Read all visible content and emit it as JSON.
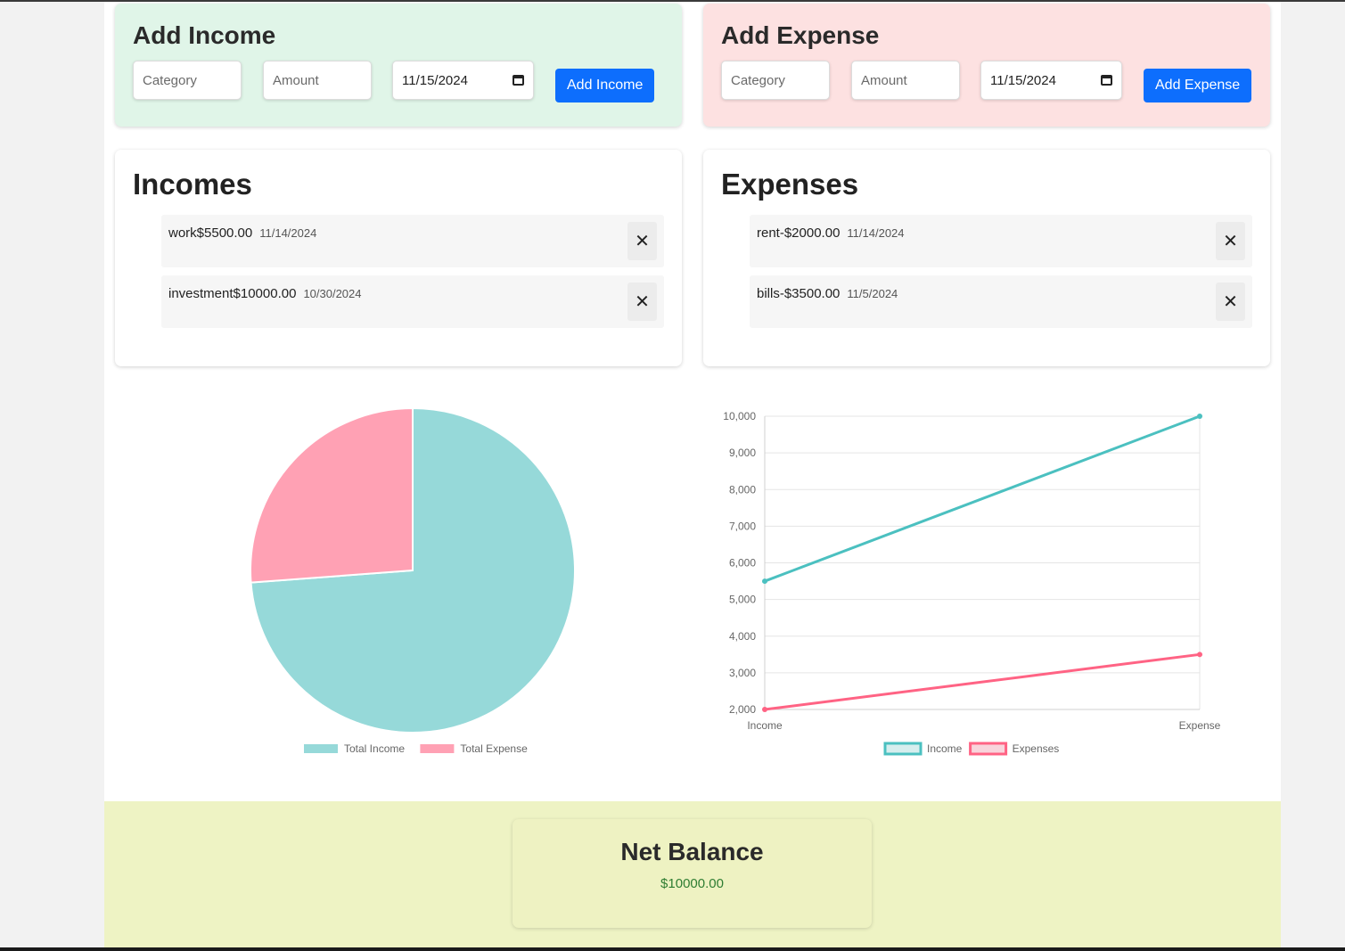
{
  "income_form": {
    "title": "Add Income",
    "category_placeholder": "Category",
    "amount_placeholder": "Amount",
    "date_value": "11/15/2024",
    "button_label": "Add Income"
  },
  "expense_form": {
    "title": "Add Expense",
    "category_placeholder": "Category",
    "amount_placeholder": "Amount",
    "date_value": "11/15/2024",
    "button_label": "Add Expense"
  },
  "incomes": {
    "title": "Incomes",
    "items": [
      {
        "text": "work$5500.00",
        "date": "11/14/2024"
      },
      {
        "text": "investment$10000.00",
        "date": "10/30/2024"
      }
    ]
  },
  "expenses": {
    "title": "Expenses",
    "items": [
      {
        "text": "rent-$2000.00",
        "date": "11/14/2024"
      },
      {
        "text": "bills-$3500.00",
        "date": "11/5/2024"
      }
    ]
  },
  "icons": {
    "delete": "close-icon",
    "calendar": "calendar-icon"
  },
  "colors": {
    "income_accent": "#4bc0c0",
    "income_fill": "#96d9d9",
    "expense_accent": "#ff6384",
    "expense_fill": "#ffa1b4",
    "button": "#0d6efd",
    "net_value": "#2e7d32"
  },
  "chart_data": [
    {
      "type": "pie",
      "labels": [
        "Total Income",
        "Total Expense"
      ],
      "values": [
        15500,
        5500
      ],
      "colors": [
        "#96d9d9",
        "#ffa1b4"
      ],
      "legend": "bottom"
    },
    {
      "type": "line",
      "categories": [
        "Income",
        "Expense"
      ],
      "series": [
        {
          "name": "Income",
          "values": [
            5500,
            10000
          ],
          "color": "#4bc0c0"
        },
        {
          "name": "Expenses",
          "values": [
            2000,
            3500
          ],
          "color": "#ff6384"
        }
      ],
      "ylim": [
        2000,
        10000
      ],
      "yticks": [
        "2,000",
        "3,000",
        "4,000",
        "5,000",
        "6,000",
        "7,000",
        "8,000",
        "9,000",
        "10,000"
      ],
      "grid": true,
      "legend": "bottom"
    }
  ],
  "net_balance": {
    "title": "Net Balance",
    "value": "$10000.00"
  }
}
